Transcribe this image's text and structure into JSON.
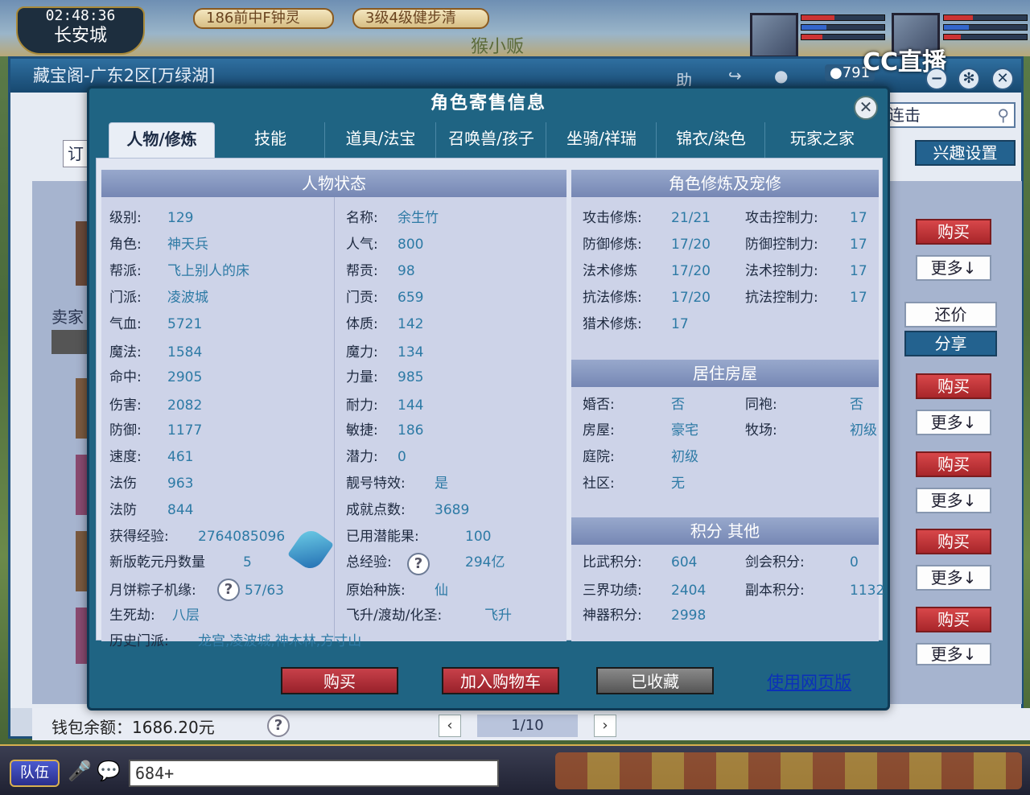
{
  "hud": {
    "time": "02:48:36",
    "city": "长安城",
    "quest1": "186前中F钟灵",
    "quest2": "3级4级健步清",
    "vendor": "猴小贩",
    "cc_logo": "CC直播",
    "chat_input": "684+",
    "team_label": "队伍"
  },
  "window": {
    "title": "藏宝阁-广东2区[万绿湖]",
    "help_label": "助",
    "badge": "791",
    "search_hint": "连击",
    "interest_btn": "兴趣设置",
    "order_btn": "订",
    "seller_label": "卖家",
    "side_buttons": {
      "buy": "购买",
      "more": "更多↓",
      "counter": "还价",
      "share": "分享"
    },
    "wallet_label": "钱包余额：1686.20元",
    "page": "1/10"
  },
  "modal": {
    "title": "角色寄售信息",
    "tabs": [
      "人物/修炼",
      "技能",
      "道具/法宝",
      "召唤兽/孩子",
      "坐骑/祥瑞",
      "锦衣/染色",
      "玩家之家"
    ],
    "status_header": "人物状态",
    "cultivation_header": "角色修炼及宠修",
    "house_header": "居住房屋",
    "score_header": "积分 其他",
    "left_col": [
      {
        "k": "级别:",
        "v": "129"
      },
      {
        "k": "角色:",
        "v": "神天兵"
      },
      {
        "k": "帮派:",
        "v": "飞上别人的床"
      },
      {
        "k": "门派:",
        "v": "凌波城"
      },
      {
        "k": "气血:",
        "v": "5721"
      },
      {
        "k": "魔法:",
        "v": "1584"
      },
      {
        "k": "命中:",
        "v": "2905"
      },
      {
        "k": "伤害:",
        "v": "2082"
      },
      {
        "k": "防御:",
        "v": "1177"
      },
      {
        "k": "速度:",
        "v": "461"
      },
      {
        "k": "法伤",
        "v": "963"
      },
      {
        "k": "法防",
        "v": "844"
      }
    ],
    "mid_col": [
      {
        "k": "名称:",
        "v": "余生竹"
      },
      {
        "k": "人气:",
        "v": "800"
      },
      {
        "k": "帮贡:",
        "v": "98"
      },
      {
        "k": "门贡:",
        "v": "659"
      },
      {
        "k": "体质:",
        "v": "142"
      },
      {
        "k": "魔力:",
        "v": "134"
      },
      {
        "k": "力量:",
        "v": "985"
      },
      {
        "k": "耐力:",
        "v": "144"
      },
      {
        "k": "敏捷:",
        "v": "186"
      },
      {
        "k": "潜力:",
        "v": "0"
      },
      {
        "k": "靓号特效:",
        "v": "是"
      },
      {
        "k": "成就点数:",
        "v": "3689"
      }
    ],
    "extra_left": [
      {
        "k": "获得经验:",
        "v": "2764085096"
      },
      {
        "k": "新版乾元丹数量",
        "v": "5"
      },
      {
        "k": "月饼粽子机缘:",
        "v": "57/63"
      },
      {
        "k": "生死劫:",
        "v": "八层"
      },
      {
        "k": "历史门派:",
        "v": "龙宫,凌波城,神木林,方寸山"
      }
    ],
    "extra_mid": [
      {
        "k": "已用潜能果:",
        "v": "100"
      },
      {
        "k": "总经验:",
        "v": "294亿"
      },
      {
        "k": "原始种族:",
        "v": "仙"
      },
      {
        "k": "飞升/渡劫/化圣:",
        "v": "飞升"
      }
    ],
    "cultivation": [
      {
        "k": "攻击修炼:",
        "v": "21/21",
        "k2": "攻击控制力:",
        "v2": "17"
      },
      {
        "k": "防御修炼:",
        "v": "17/20",
        "k2": "防御控制力:",
        "v2": "17"
      },
      {
        "k": "法术修炼",
        "v": "17/20",
        "k2": "法术控制力:",
        "v2": "17"
      },
      {
        "k": "抗法修炼:",
        "v": "17/20",
        "k2": "抗法控制力:",
        "v2": "17"
      },
      {
        "k": "猎术修炼:",
        "v": "17",
        "k2": "",
        "v2": ""
      }
    ],
    "house": [
      {
        "k": "婚否:",
        "v": "否",
        "k2": "同袍:",
        "v2": "否"
      },
      {
        "k": "房屋:",
        "v": "豪宅",
        "k2": "牧场:",
        "v2": "初级"
      },
      {
        "k": "庭院:",
        "v": "初级",
        "k2": "",
        "v2": ""
      },
      {
        "k": "社区:",
        "v": "无",
        "k2": "",
        "v2": ""
      }
    ],
    "scores": [
      {
        "k": "比武积分:",
        "v": "604",
        "k2": "剑会积分:",
        "v2": "0"
      },
      {
        "k": "三界功绩:",
        "v": "2404",
        "k2": "副本积分:",
        "v2": "1132"
      },
      {
        "k": "神器积分:",
        "v": "2998",
        "k2": "",
        "v2": ""
      }
    ],
    "footer": {
      "buy": "购买",
      "add_cart": "加入购物车",
      "favorited": "已收藏",
      "web_link": "使用网页版"
    }
  },
  "colors": {
    "modal_bg": "#1f6483",
    "value_blue": "#2d7aa5",
    "buy_red": "#b52e33"
  }
}
